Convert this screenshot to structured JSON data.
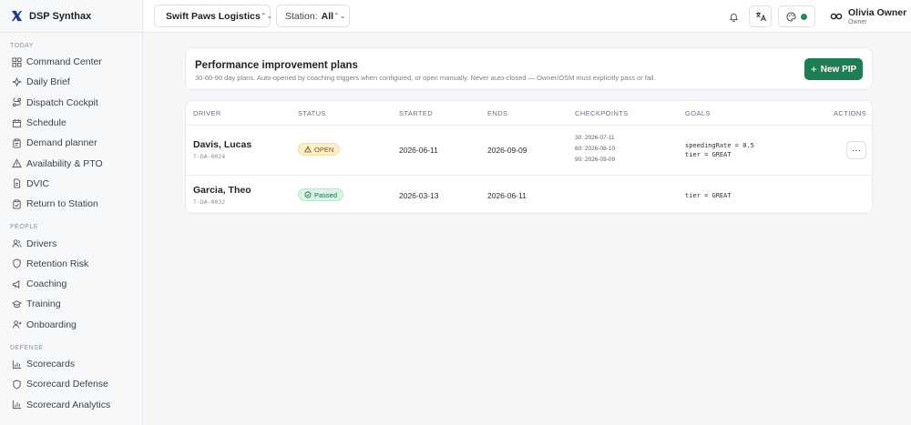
{
  "brand": {
    "name": "DSP Synthax"
  },
  "sidebar": {
    "sections": [
      {
        "heading": "TODAY",
        "items": [
          {
            "label": "Command Center",
            "icon": "dashboard-icon"
          },
          {
            "label": "Daily Brief",
            "icon": "sparkle-icon"
          },
          {
            "label": "Dispatch Cockpit",
            "icon": "route-icon"
          },
          {
            "label": "Schedule",
            "icon": "calendar-icon"
          },
          {
            "label": "Demand planner",
            "icon": "clipboard-icon"
          },
          {
            "label": "Availability & PTO",
            "icon": "warning-icon"
          },
          {
            "label": "DVIC",
            "icon": "document-icon"
          },
          {
            "label": "Return to Station",
            "icon": "clipboard-check-icon"
          }
        ]
      },
      {
        "heading": "PEOPLE",
        "items": [
          {
            "label": "Drivers",
            "icon": "users-icon"
          },
          {
            "label": "Retention Risk",
            "icon": "shield-icon"
          },
          {
            "label": "Coaching",
            "icon": "megaphone-icon"
          },
          {
            "label": "Training",
            "icon": "graduation-cap-icon"
          },
          {
            "label": "Onboarding",
            "icon": "user-plus-icon"
          }
        ]
      },
      {
        "heading": "DEFENSE",
        "items": [
          {
            "label": "Scorecards",
            "icon": "bar-chart-icon"
          },
          {
            "label": "Scorecard Defense",
            "icon": "shield-icon"
          },
          {
            "label": "Scorecard Analytics",
            "icon": "bar-chart-icon"
          }
        ]
      }
    ]
  },
  "topbar": {
    "org": "Swift Paws Logistics",
    "station_label": "Station:",
    "station_value": "All",
    "user_name": "Olivia Owner",
    "user_role": "Owner",
    "theme_color": "#1f8a5b"
  },
  "page": {
    "title": "Performance improvement plans",
    "subtitle": "30-60-90 day plans. Auto-opened by coaching triggers when configured, or open manually. Never auto-closed — Owner/OSM must explicitly pass or fail.",
    "new_button": "New PIP"
  },
  "table": {
    "columns": [
      "DRIVER",
      "STATUS",
      "STARTED",
      "ENDS",
      "CHECKPOINTS",
      "GOALS",
      "ACTIONS"
    ],
    "rows": [
      {
        "name": "Davis, Lucas",
        "id": "T-DA-0024",
        "status": "OPEN",
        "started": "2026-06-11",
        "ends": "2026-09-09",
        "checkpoints": [
          "30: 2026-07-11",
          "60: 2026-08-10",
          "90: 2026-09-09"
        ],
        "goals": [
          "speedingRate = 0.5",
          "tier = GREAT"
        ]
      },
      {
        "name": "Garcia, Theo",
        "id": "T-DA-0032",
        "status": "Passed",
        "started": "2026-03-13",
        "ends": "2026-06-11",
        "checkpoints": [],
        "goals": [
          "tier = GREAT"
        ]
      }
    ]
  },
  "colors": {
    "accent": "#1c7e52",
    "open_badge": "#fbefcc",
    "passed_badge": "#d8f4e5"
  }
}
